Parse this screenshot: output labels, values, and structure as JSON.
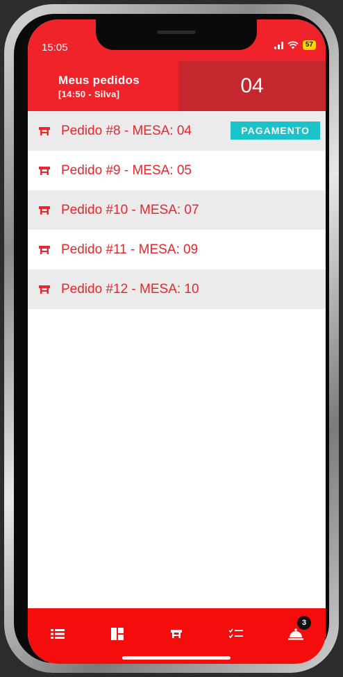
{
  "status_bar": {
    "time": "15:05",
    "battery": "57"
  },
  "header": {
    "title": "Meus pedidos",
    "subtitle": "[14:50 - Silva]",
    "table_number": "04"
  },
  "orders": [
    {
      "label": "Pedido #8 - MESA: 04",
      "badge": "PAGAMENTO"
    },
    {
      "label": "Pedido #9 - MESA: 05"
    },
    {
      "label": "Pedido #10 - MESA: 07"
    },
    {
      "label": "Pedido #11 - MESA: 09"
    },
    {
      "label": "Pedido #12 - MESA: 10"
    }
  ],
  "bottom_nav": {
    "items": [
      "list-icon",
      "dashboard-icon",
      "table-icon",
      "checklist-icon",
      "bell-icon"
    ],
    "notification_count": "3"
  },
  "colors": {
    "primary": "#f0222a",
    "header_dark": "#c4272d",
    "badge": "#19c3c9",
    "row_alt": "#ebebeb"
  }
}
